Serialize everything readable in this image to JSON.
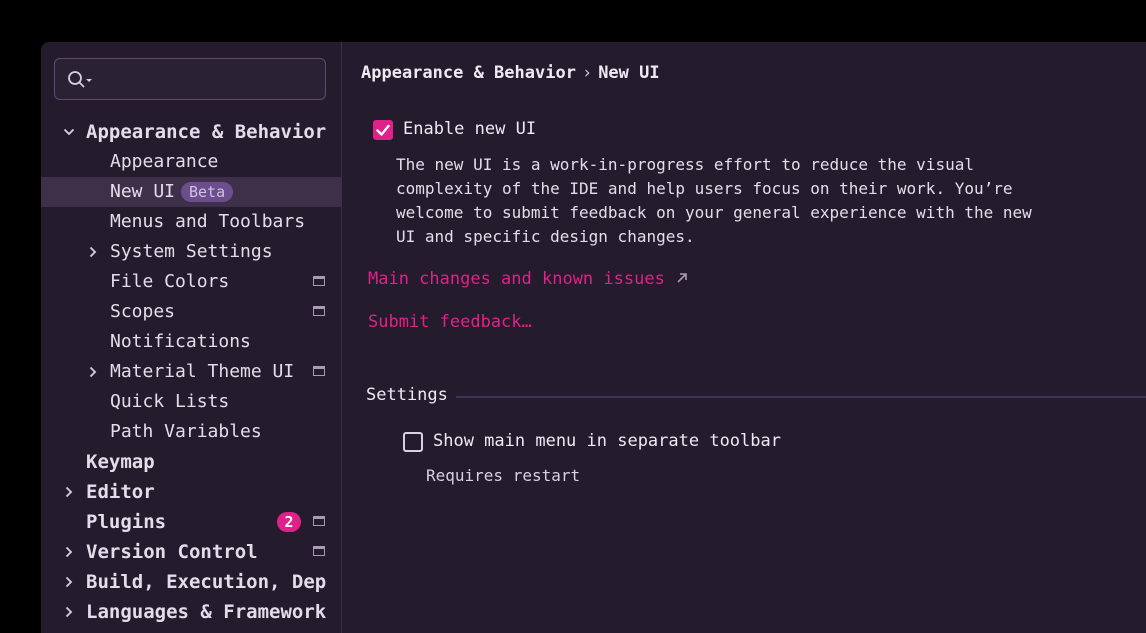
{
  "sidebar": {
    "search": {
      "placeholder": ""
    },
    "items": [
      {
        "label": "Appearance & Behavior",
        "bold": true,
        "expanded": true
      },
      {
        "label": "Appearance"
      },
      {
        "label": "New UI",
        "badge": "Beta",
        "selected": true
      },
      {
        "label": "Menus and Toolbars"
      },
      {
        "label": "System Settings",
        "collapsed": true
      },
      {
        "label": "File Colors",
        "project_icon": true
      },
      {
        "label": "Scopes",
        "project_icon": true
      },
      {
        "label": "Notifications"
      },
      {
        "label": "Material Theme UI",
        "collapsed": true,
        "project_icon": true
      },
      {
        "label": "Quick Lists"
      },
      {
        "label": "Path Variables"
      },
      {
        "label": "Keymap",
        "bold": true
      },
      {
        "label": "Editor",
        "bold": true,
        "collapsed": true
      },
      {
        "label": "Plugins",
        "bold": true,
        "count": "2",
        "project_icon": true
      },
      {
        "label": "Version Control",
        "bold": true,
        "collapsed": true,
        "project_icon": true
      },
      {
        "label": "Build, Execution, Deployment",
        "bold": true,
        "collapsed": true
      },
      {
        "label": "Languages & Frameworks",
        "bold": true,
        "collapsed": true
      }
    ]
  },
  "main": {
    "breadcrumb": {
      "parent": "Appearance & Behavior",
      "separator": "›",
      "current": "New UI"
    },
    "enable_new_ui": {
      "label": "Enable new UI",
      "checked": true
    },
    "description": "The new UI is a work-in-progress effort to reduce the visual complexity of the IDE and help users focus on their work. You’re welcome to submit feedback on your general experience with the new UI and specific design changes.",
    "links": {
      "changes": "Main changes and known issues",
      "feedback": "Submit feedback…"
    },
    "settings_section": {
      "title": "Settings"
    },
    "show_main_menu": {
      "label": "Show main menu in separate toolbar",
      "checked": false,
      "hint": "Requires restart"
    }
  },
  "colors": {
    "accent": "#e0218a",
    "background": "#241c2c",
    "selected_row": "#3e3049",
    "beta_badge": "#6b4e8e"
  },
  "icons": {
    "search": "search-icon",
    "expand": "chevron-down-icon",
    "collapse": "chevron-right-icon",
    "project_scope": "project-scope-icon",
    "external_link": "external-link-arrow-icon",
    "check": "check-icon"
  }
}
